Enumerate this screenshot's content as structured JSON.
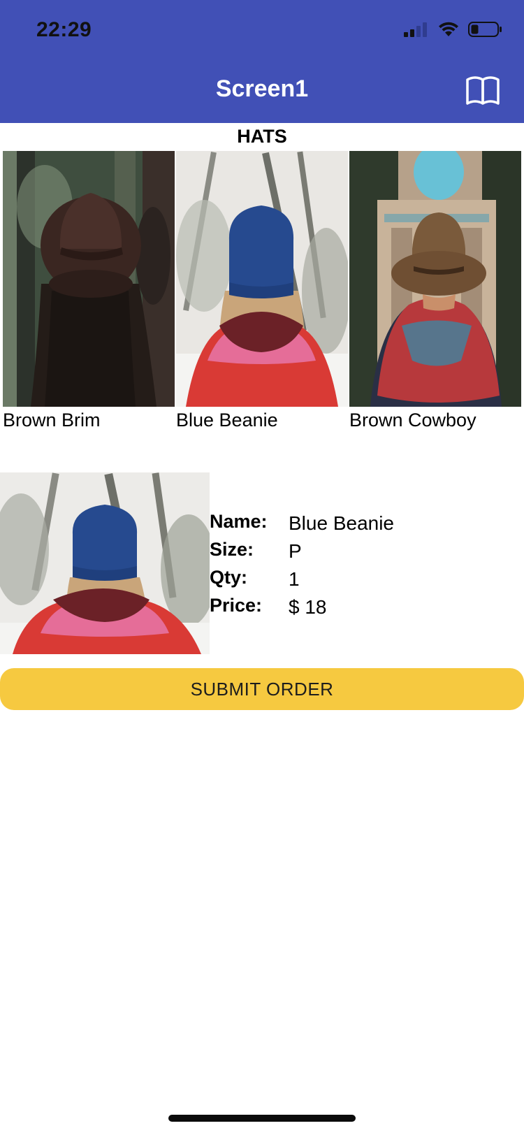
{
  "status_bar": {
    "time": "22:29",
    "icons": [
      "cellular-signal-icon",
      "wifi-icon",
      "battery-icon"
    ]
  },
  "app_bar": {
    "title": "Screen1",
    "action_icon": "book-icon",
    "background_color": "#4150b6"
  },
  "section": {
    "heading": "HATS"
  },
  "gallery": {
    "items": [
      {
        "label": "Brown Brim"
      },
      {
        "label": "Blue Beanie"
      },
      {
        "label": "Brown Cowboy"
      }
    ]
  },
  "order_detail": {
    "image": "Blue Beanie",
    "fields": [
      {
        "label": "Name:",
        "value": "Blue Beanie"
      },
      {
        "label": "Size:",
        "value": "P"
      },
      {
        "label": "Qty:",
        "value": "1"
      },
      {
        "label": "Price:",
        "value": "$ 18"
      }
    ]
  },
  "submit_button": {
    "label": "SUBMIT ORDER",
    "color": "#f6c940"
  }
}
